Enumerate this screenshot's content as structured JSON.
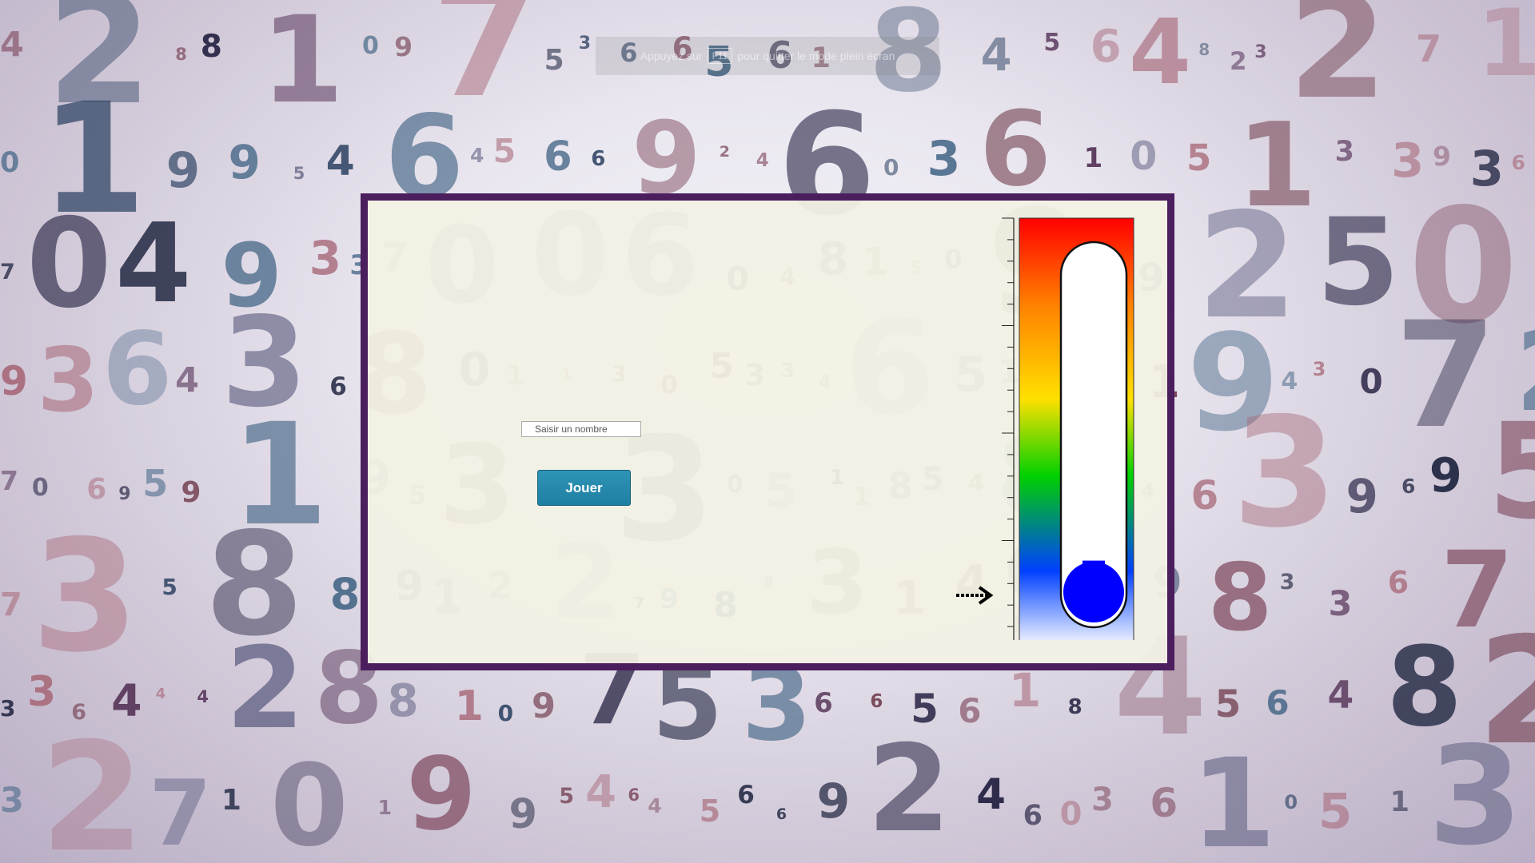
{
  "fullscreen_banner": {
    "prefix": "Appuyez sur",
    "key": "F11",
    "suffix": "pour quitter le mode plein écran"
  },
  "game": {
    "input_placeholder": "Saisir un nombre",
    "input_value": "",
    "play_button_label": "Jouer"
  },
  "thermometer": {
    "level": 0.09,
    "gradient_colors": [
      "#ff0000",
      "#ff8000",
      "#ffe000",
      "#00d000",
      "#0040ff",
      "#ffffff"
    ],
    "bulb_color": "#0000ff",
    "indicator_icon": "dashed-arrow-right-icon"
  },
  "colors": {
    "panel_border": "#4b1e5e",
    "panel_background": "#f2f1e3",
    "button": "#1e7fa2"
  },
  "background_digits": [
    "4",
    "2",
    "8",
    "8",
    "1",
    "0",
    "9",
    "7",
    "5",
    "3",
    "6",
    "6",
    "5",
    "6",
    "1",
    "8",
    "4",
    "5",
    "6",
    "4",
    "8",
    "2",
    "3",
    "2",
    "7",
    "1",
    "0",
    "1",
    "9",
    "9",
    "5",
    "4",
    "6",
    "4",
    "5",
    "6",
    "6",
    "9",
    "2",
    "4",
    "6",
    "0",
    "3",
    "6",
    "1",
    "0",
    "5",
    "1",
    "3",
    "3",
    "9",
    "3",
    "6",
    "7",
    "0",
    "4",
    "9",
    "3",
    "3",
    "7",
    "0",
    "0",
    "6",
    "0",
    "4",
    "8",
    "1",
    "5",
    "0",
    "9",
    "0",
    "9",
    "2",
    "5",
    "0",
    "9",
    "3",
    "6",
    "4",
    "3",
    "6",
    "8",
    "0",
    "1",
    "1",
    "3",
    "0",
    "5",
    "3",
    "3",
    "4",
    "6",
    "5",
    "1",
    "6",
    "5",
    "1",
    "9",
    "4",
    "3",
    "0",
    "7",
    "2",
    "7",
    "0",
    "6",
    "9",
    "5",
    "9",
    "1",
    "9",
    "5",
    "3",
    "1",
    "1",
    "3",
    "0",
    "5",
    "1",
    "1",
    "8",
    "5",
    "4",
    "8",
    "7",
    "4",
    "6",
    "3",
    "9",
    "6",
    "9",
    "5",
    "7",
    "3",
    "5",
    "8",
    "8",
    "9",
    "1",
    "2",
    "2",
    "7",
    "9",
    "8",
    "8",
    "3",
    "1",
    "4",
    "9",
    "2",
    "9",
    "8",
    "3",
    "3",
    "6",
    "7",
    "3",
    "3",
    "6",
    "4",
    "4"
  ]
}
